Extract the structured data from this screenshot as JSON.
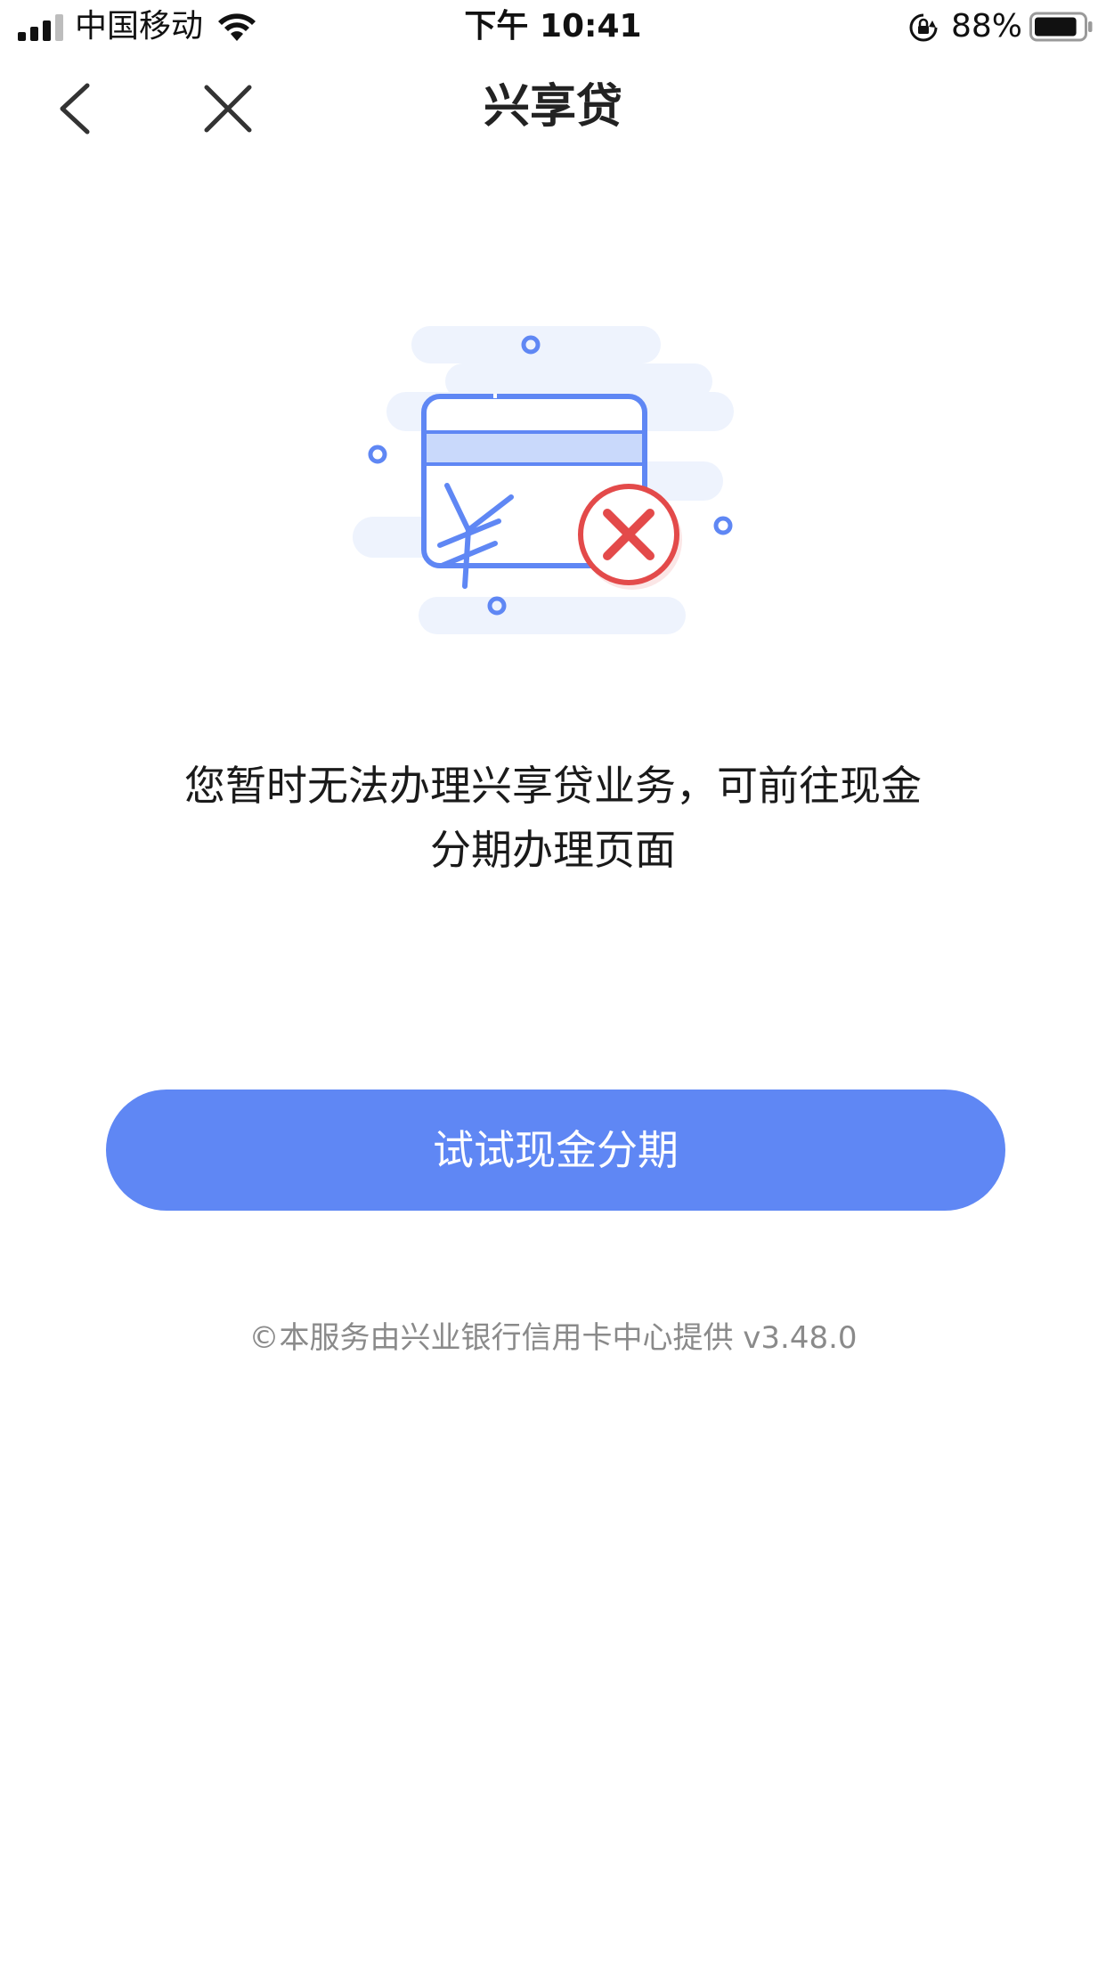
{
  "status_bar": {
    "carrier": "中国移动",
    "time": "下午 10:41",
    "battery_percent": "88%",
    "battery_level": 0.88,
    "icons": [
      "signal-icon",
      "wifi-icon",
      "rotation-lock-icon",
      "battery-icon"
    ]
  },
  "nav": {
    "title": "兴享贷",
    "back_icon": "chevron-left-icon",
    "close_icon": "close-icon"
  },
  "illustration": {
    "icon": "credit-card-unavailable-icon",
    "colors": {
      "card": "#5f87f4",
      "stripe": "#c9d9fb",
      "bg_cloud": "#eef3fd",
      "error": "#e34a4a",
      "error_bg": "#fbe6e6"
    }
  },
  "message": {
    "line1": "您暂时无法办理兴享贷业务，可前往现金",
    "line2": "分期办理页面"
  },
  "cta": {
    "label": "试试现金分期",
    "color": "#5f87f4"
  },
  "footer": {
    "text": "©本服务由兴业银行信用卡中心提供 v3.48.0"
  }
}
